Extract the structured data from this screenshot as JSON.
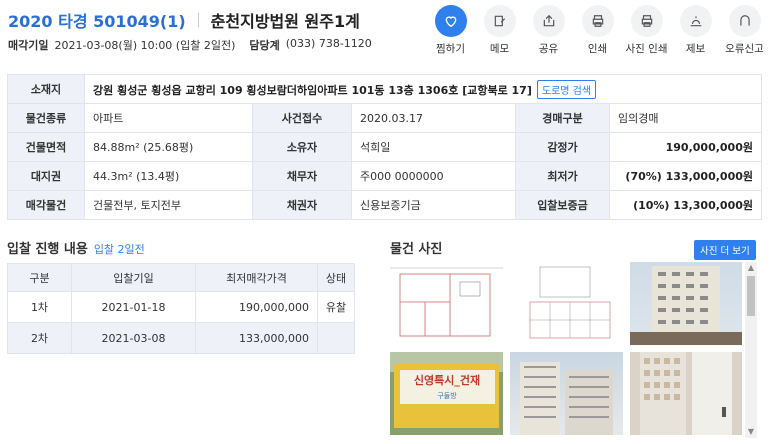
{
  "header": {
    "case_no": "2020 타경 501049(1)",
    "court": "춘천지방법원 원주1계",
    "sale_date_label": "매각기일",
    "sale_date_value": "2021-03-08(월) 10:00 (입찰 2일전)",
    "dept_label": "담당계",
    "dept_value": "(033) 738-1120"
  },
  "actions": [
    {
      "label": "찜하기",
      "icon": "heart-icon"
    },
    {
      "label": "메모",
      "icon": "memo-icon"
    },
    {
      "label": "공유",
      "icon": "share-icon"
    },
    {
      "label": "인쇄",
      "icon": "print-icon"
    },
    {
      "label": "사진 인쇄",
      "icon": "photo-print-icon"
    },
    {
      "label": "제보",
      "icon": "report-icon"
    },
    {
      "label": "오류신고",
      "icon": "error-report-icon"
    }
  ],
  "info": {
    "location_label": "소재지",
    "location_value": "강원 횡성군 횡성읍 교항리 109 횡성보람더하임아파트 101동 13층 1306호 [교항북로 17]",
    "road_btn": "도로명 검색",
    "type_label": "물건종류",
    "type_value": "아파트",
    "receipt_label": "사건접수",
    "receipt_value": "2020.03.17",
    "auction_type_label": "경매구분",
    "auction_type_value": "임의경매",
    "area_label": "건물면적",
    "area_value": "84.88m² (25.68평)",
    "owner_label": "소유자",
    "owner_value": "석희일",
    "appraisal_label": "감정가",
    "appraisal_value": "190,000,000원",
    "land_label": "대지권",
    "land_value": "44.3m² (13.4평)",
    "debtor_label": "채무자",
    "debtor_value": "주000 0000000",
    "min_price_label": "최저가",
    "min_price_value": "(70%) 133,000,000원",
    "sale_item_label": "매각물건",
    "sale_item_value": "건물전부, 토지전부",
    "creditor_label": "채권자",
    "creditor_value": "신용보증기금",
    "deposit_label": "입찰보증금",
    "deposit_value": "(10%) 13,300,000원"
  },
  "bid": {
    "title": "입찰 진행 내용",
    "subtitle": "입찰 2일전",
    "headers": [
      "구분",
      "입찰기일",
      "최저매각가격",
      "상태"
    ],
    "rows": [
      [
        "1차",
        "2021-01-18",
        "190,000,000",
        "유찰"
      ],
      [
        "2차",
        "2021-03-08",
        "133,000,000",
        ""
      ]
    ]
  },
  "photos": {
    "title": "물건 사진",
    "more": "사진 더 보기",
    "banner_text": "신영특시_건재 구들방"
  },
  "colors": {
    "accent": "#2f80ed",
    "header_bg": "#eef2f8",
    "border": "#e1e4ea"
  }
}
